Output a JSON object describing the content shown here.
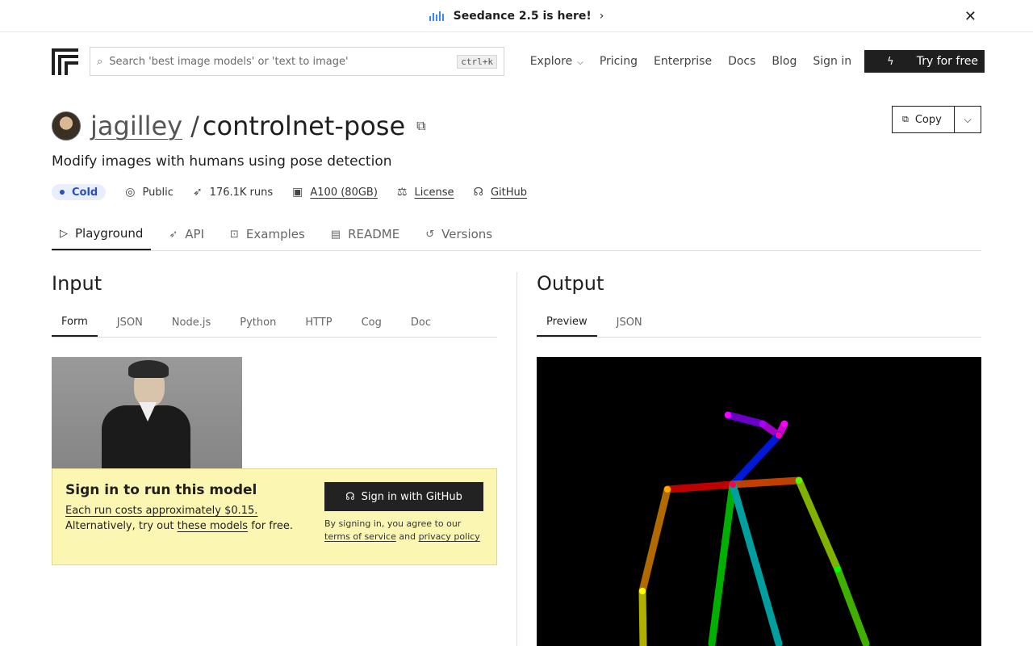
{
  "banner": {
    "text": "Seedance 2.5 is here!",
    "chevron": "›",
    "close": "✕"
  },
  "nav": {
    "search_placeholder": "Search 'best image models' or 'text to image'",
    "shortcut": "ctrl+k",
    "links": {
      "explore": "Explore",
      "pricing": "Pricing",
      "enterprise": "Enterprise",
      "docs": "Docs",
      "blog": "Blog",
      "signin": "Sign in"
    },
    "cta": "Try for free"
  },
  "model": {
    "owner": "jagilley",
    "slash": "/",
    "name": "controlnet-pose",
    "description": "Modify images with humans using pose detection",
    "copy_label": "Copy"
  },
  "meta": {
    "status": "Cold",
    "visibility": "Public",
    "runs": "176.1K runs",
    "hardware": "A100 (80GB)",
    "license": "License",
    "github": "GitHub"
  },
  "tabs": [
    "Playground",
    "API",
    "Examples",
    "README",
    "Versions"
  ],
  "input": {
    "title": "Input",
    "subtabs": [
      "Form",
      "JSON",
      "Node.js",
      "Python",
      "HTTP",
      "Cog",
      "Doc"
    ]
  },
  "output": {
    "title": "Output",
    "subtabs": [
      "Preview",
      "JSON"
    ]
  },
  "signin_panel": {
    "title": "Sign in to run this model",
    "cost": "Each run costs approximately $0.15.",
    "alt_prefix": "Alternatively, try out ",
    "alt_link": "these models",
    "alt_suffix": " for free.",
    "button": "Sign in with GitHub",
    "terms_prefix": "By signing in, you agree to our",
    "terms_link": "terms of service",
    "terms_and": " and ",
    "privacy_link": "privacy policy"
  },
  "colors": {
    "accent_dark": "#1f1f1f",
    "cold_bg": "#e8eefc",
    "cold_text": "#2b4fb8",
    "signin_bg": "#fcf6b3"
  }
}
